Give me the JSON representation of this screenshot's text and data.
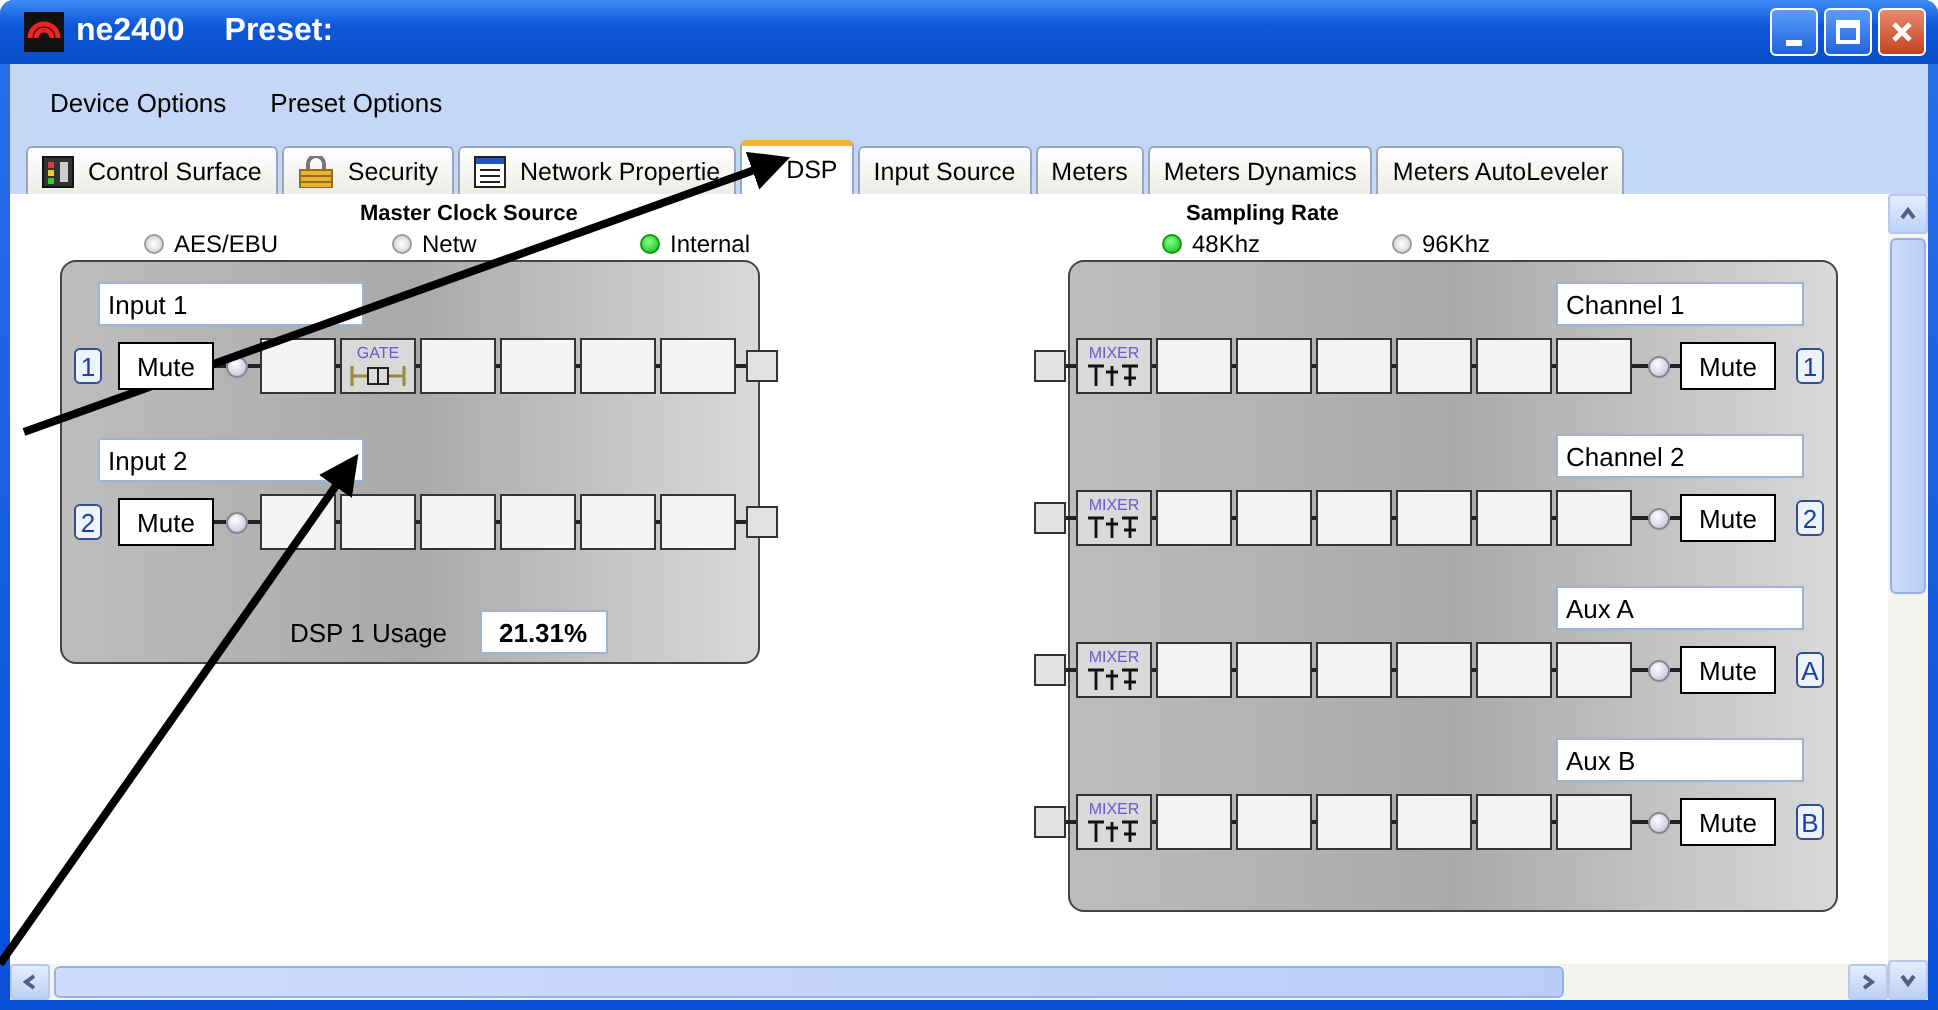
{
  "window": {
    "title": "ne2400",
    "subtitle": "Preset:"
  },
  "menu": [
    "Device Options",
    "Preset Options"
  ],
  "tabs": [
    {
      "label": "Control Surface",
      "kind": "meter",
      "selected": false
    },
    {
      "label": "Security",
      "kind": "lock",
      "selected": false
    },
    {
      "label": "Network Propertie",
      "kind": "window",
      "selected": false
    },
    {
      "label": "DSP",
      "kind": "plain",
      "selected": true
    },
    {
      "label": "Input Source",
      "kind": "plain",
      "selected": false
    },
    {
      "label": "Meters",
      "kind": "plain",
      "selected": false
    },
    {
      "label": "Meters Dynamics",
      "kind": "plain",
      "selected": false
    },
    {
      "label": "Meters AutoLeveler",
      "kind": "plain",
      "selected": false
    }
  ],
  "master_clock": {
    "title": "Master Clock Source",
    "options": [
      {
        "label": "AES/EBU",
        "selected": false
      },
      {
        "label": "Netw",
        "selected": false
      },
      {
        "label": "Internal",
        "selected": true
      }
    ]
  },
  "inputs": [
    {
      "name": "Input 1",
      "number": "1",
      "mute": "Mute",
      "blocks": [
        {
          "kind": "empty"
        },
        {
          "kind": "gate",
          "label": "GATE"
        },
        {
          "kind": "empty"
        },
        {
          "kind": "empty"
        },
        {
          "kind": "empty"
        },
        {
          "kind": "empty"
        }
      ]
    },
    {
      "name": "Input 2",
      "number": "2",
      "mute": "Mute",
      "blocks": [
        {
          "kind": "empty"
        },
        {
          "kind": "empty"
        },
        {
          "kind": "empty"
        },
        {
          "kind": "empty"
        },
        {
          "kind": "empty"
        },
        {
          "kind": "empty"
        }
      ]
    }
  ],
  "dsp_usage": {
    "label": "DSP 1 Usage",
    "value": "21.31%"
  },
  "sampling_rate": {
    "title": "Sampling Rate",
    "options": [
      {
        "label": "48Khz",
        "selected": true
      },
      {
        "label": "96Khz",
        "selected": false
      }
    ]
  },
  "outputs": [
    {
      "name": "Channel 1",
      "number": "1",
      "mute": "Mute",
      "blocks": [
        {
          "kind": "mixer",
          "label": "MIXER"
        },
        {
          "kind": "empty"
        },
        {
          "kind": "empty"
        },
        {
          "kind": "empty"
        },
        {
          "kind": "empty"
        },
        {
          "kind": "empty"
        },
        {
          "kind": "empty"
        }
      ]
    },
    {
      "name": "Channel 2",
      "number": "2",
      "mute": "Mute",
      "blocks": [
        {
          "kind": "mixer",
          "label": "MIXER"
        },
        {
          "kind": "empty"
        },
        {
          "kind": "empty"
        },
        {
          "kind": "empty"
        },
        {
          "kind": "empty"
        },
        {
          "kind": "empty"
        },
        {
          "kind": "empty"
        }
      ]
    },
    {
      "name": "Aux A",
      "number": "A",
      "mute": "Mute",
      "blocks": [
        {
          "kind": "mixer",
          "label": "MIXER"
        },
        {
          "kind": "empty"
        },
        {
          "kind": "empty"
        },
        {
          "kind": "empty"
        },
        {
          "kind": "empty"
        },
        {
          "kind": "empty"
        },
        {
          "kind": "empty"
        }
      ]
    },
    {
      "name": "Aux B",
      "number": "B",
      "mute": "Mute",
      "blocks": [
        {
          "kind": "mixer",
          "label": "MIXER"
        },
        {
          "kind": "empty"
        },
        {
          "kind": "empty"
        },
        {
          "kind": "empty"
        },
        {
          "kind": "empty"
        },
        {
          "kind": "empty"
        },
        {
          "kind": "empty"
        }
      ]
    }
  ]
}
